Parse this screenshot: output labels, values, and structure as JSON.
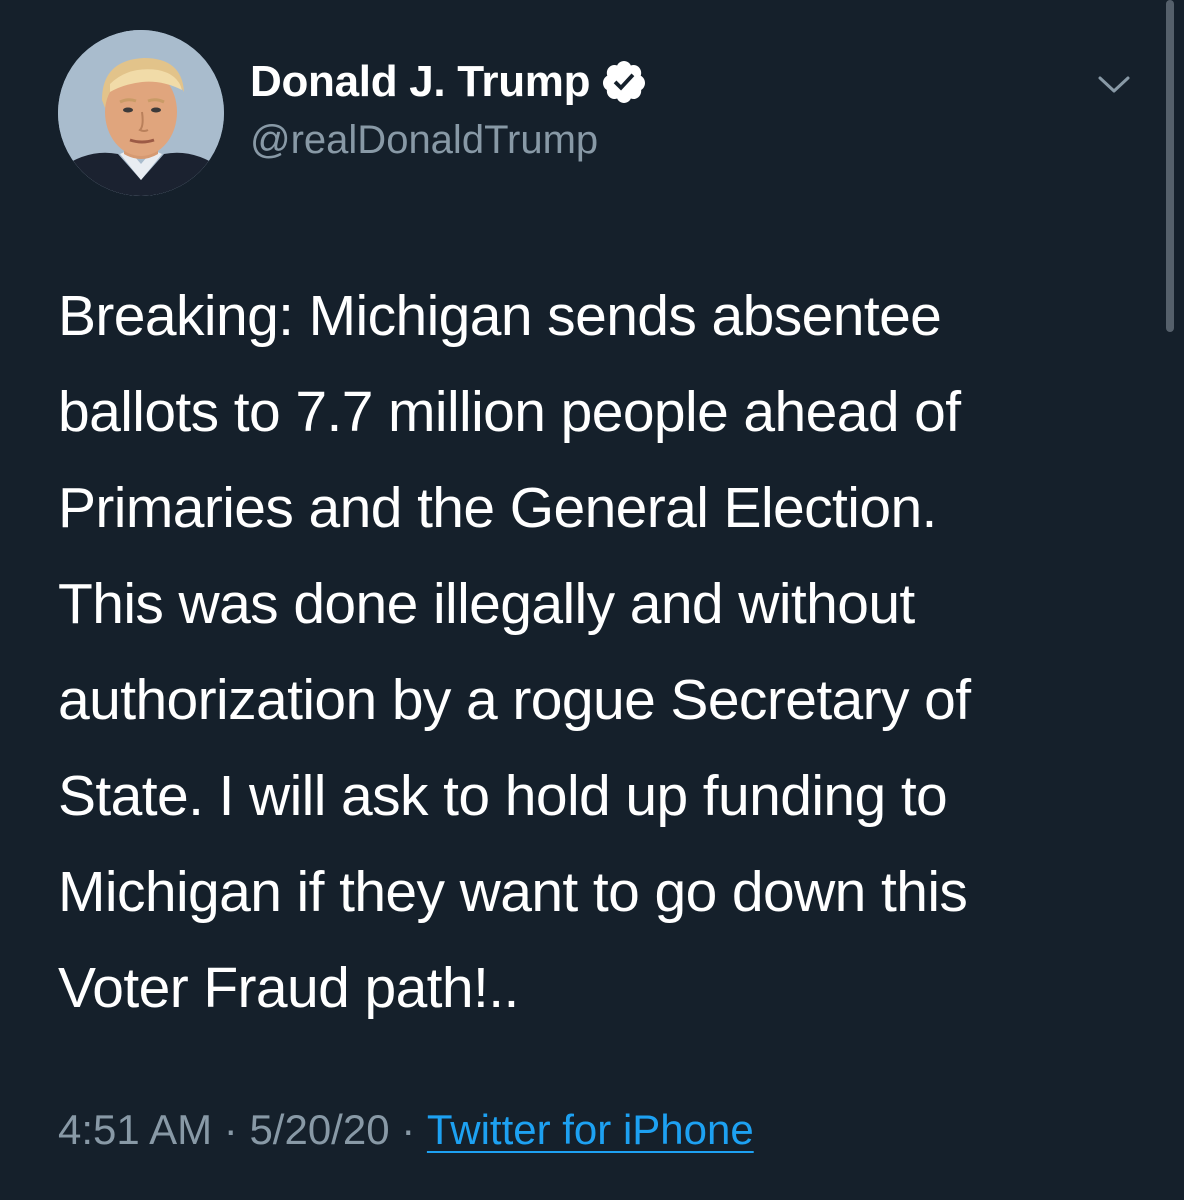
{
  "tweet": {
    "author": {
      "display_name": "Donald J. Trump",
      "handle": "@realDonaldTrump",
      "verified": true,
      "verified_icon": "verified-badge-icon",
      "avatar": "profile-photo"
    },
    "menu_icon": "chevron-down-icon",
    "text": "Breaking: Michigan sends absentee\nballots to 7.7 million people ahead of\nPrimaries and the General Election.\nThis was done illegally and without\nauthorization by a rogue Secretary of\nState. I will ask to hold up funding to\nMichigan if they want to go down this\nVoter Fraud path!..",
    "time": "4:51 AM",
    "separator": " · ",
    "date": "5/20/20",
    "source": "Twitter for iPhone"
  },
  "colors": {
    "background": "#15202b",
    "text": "#ffffff",
    "secondary": "#8899a6",
    "link": "#1da1f2"
  }
}
